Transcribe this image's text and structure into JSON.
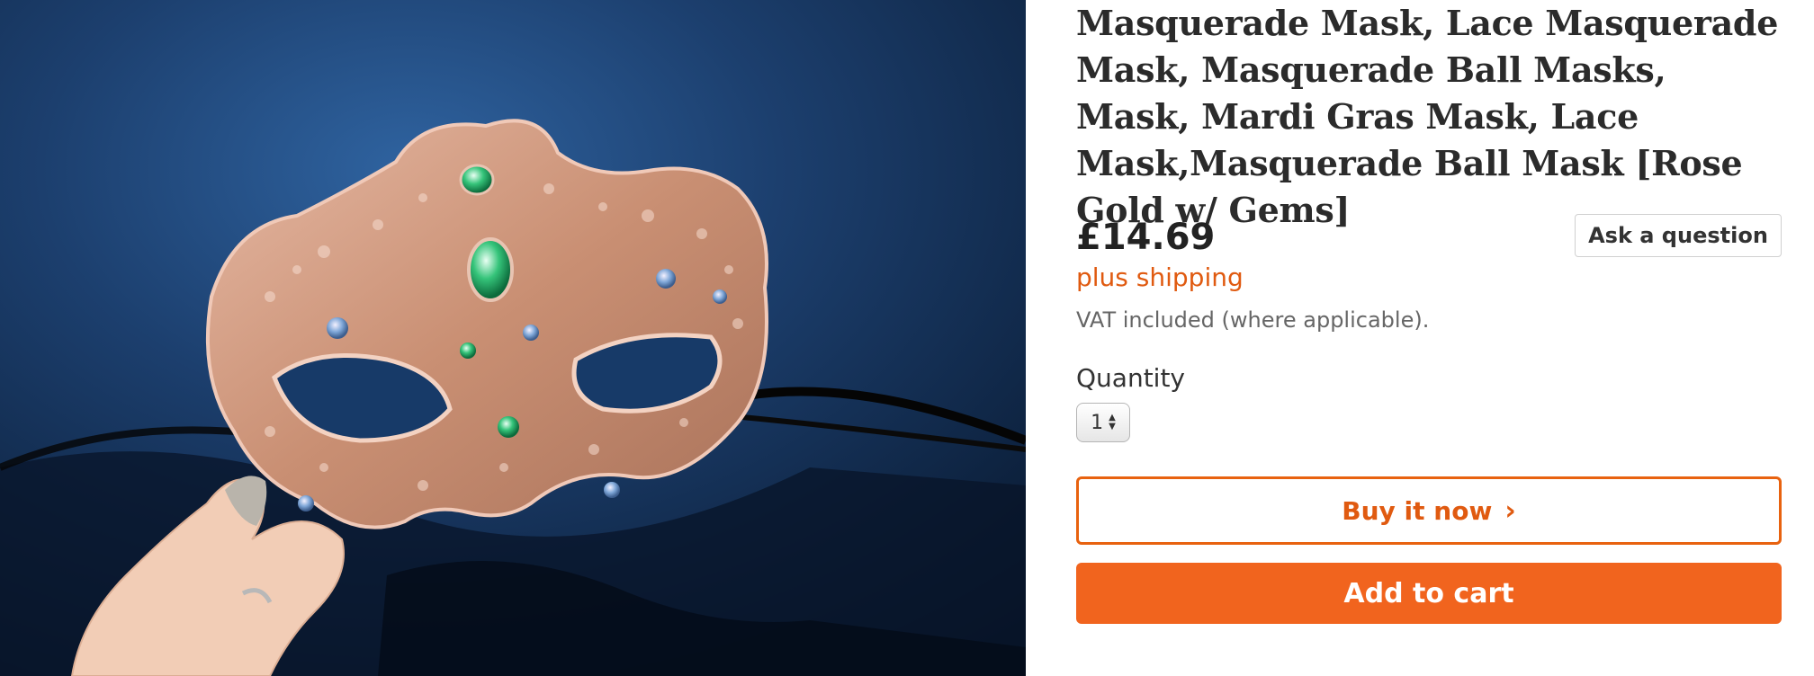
{
  "listing": {
    "title": "Masquerade Mask, Lace Masquerade Mask, Masquerade Ball Masks, Mask, Mardi Gras Mask, Lace Mask,Masquerade Ball Mask [Rose Gold w/ Gems]",
    "price": "£14.69",
    "shipping_note": "plus shipping",
    "vat_note": "VAT included (where applicable).",
    "ask_question_label": "Ask a question"
  },
  "quantity": {
    "label": "Quantity",
    "selected": "1"
  },
  "actions": {
    "buy_now_label": "Buy it now",
    "add_to_cart_label": "Add to cart"
  },
  "colors": {
    "accent_orange": "#f1641e",
    "shipping_text": "#e05a10"
  },
  "icons": {
    "buy_now_icon": "chevron-right-icon",
    "quantity_icon": "updown-arrows-icon"
  }
}
